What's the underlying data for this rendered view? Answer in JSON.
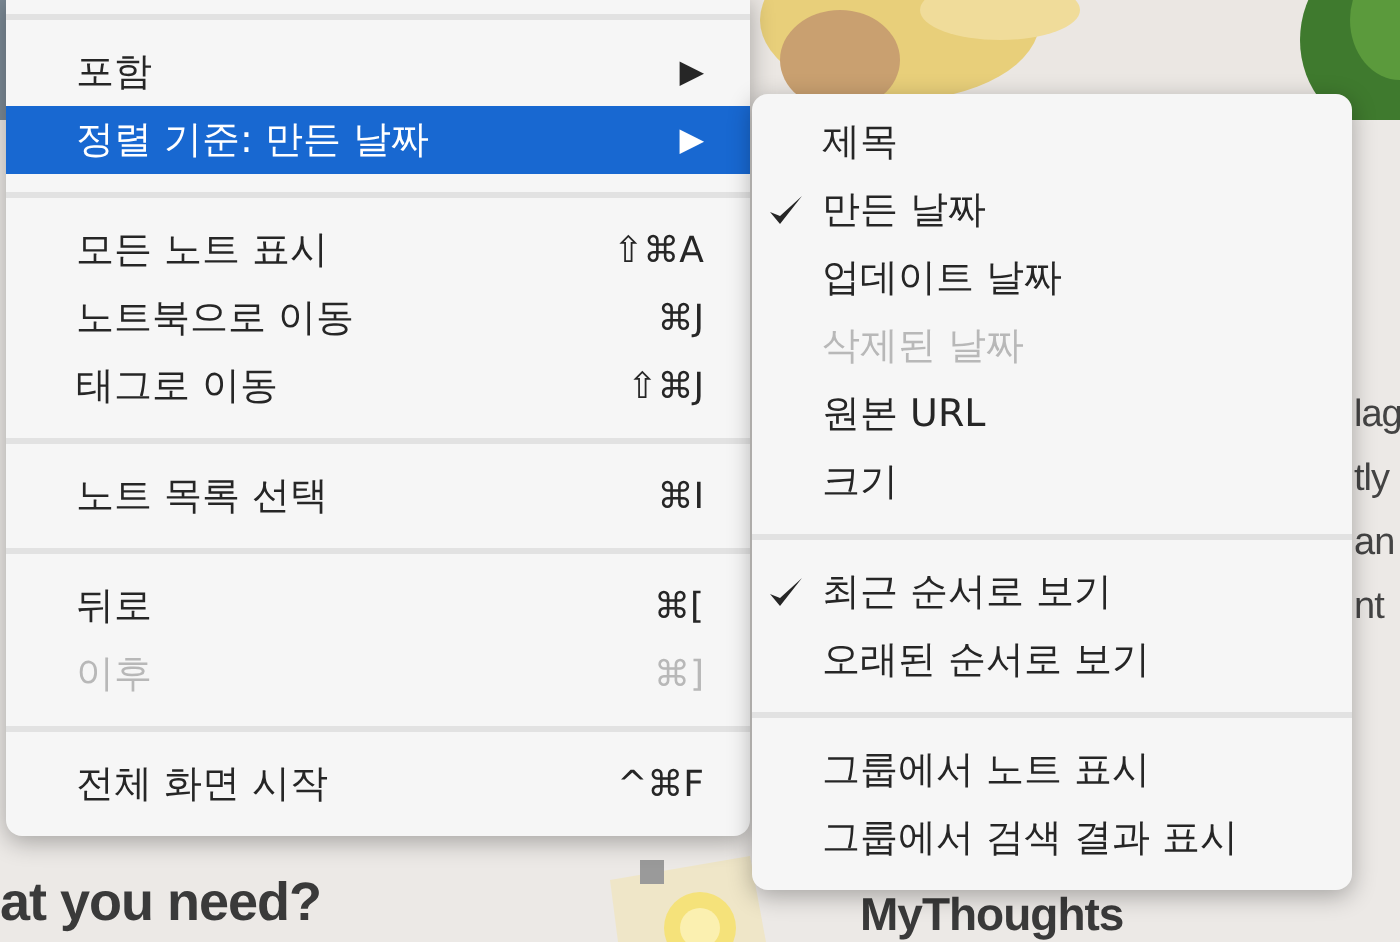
{
  "background": {
    "texts": [
      {
        "kind": "heading",
        "text": "at you need?"
      },
      {
        "kind": "title",
        "text": "MyThoughts"
      },
      {
        "kind": "body",
        "text": "lag"
      },
      {
        "kind": "body",
        "text": "tly"
      },
      {
        "kind": "body",
        "text": "an"
      },
      {
        "kind": "body",
        "text": "nt"
      }
    ]
  },
  "menu": {
    "items": [
      {
        "kind": "separator"
      },
      {
        "kind": "item",
        "label": "포함",
        "arrow": "▶",
        "selected": false,
        "disabled": false
      },
      {
        "kind": "item",
        "label": "정렬 기준: 만든 날짜",
        "arrow": "▶",
        "selected": true,
        "disabled": false
      },
      {
        "kind": "separator"
      },
      {
        "kind": "item",
        "label": "모든 노트 표시",
        "shortcut": "⇧⌘A",
        "selected": false,
        "disabled": false
      },
      {
        "kind": "item",
        "label": "노트북으로 이동",
        "shortcut": "⌘J",
        "selected": false,
        "disabled": false
      },
      {
        "kind": "item",
        "label": "태그로 이동",
        "shortcut": "⇧⌘J",
        "selected": false,
        "disabled": false
      },
      {
        "kind": "separator"
      },
      {
        "kind": "item",
        "label": "노트 목록 선택",
        "shortcut": "⌘I",
        "selected": false,
        "disabled": false
      },
      {
        "kind": "separator"
      },
      {
        "kind": "item",
        "label": "뒤로",
        "shortcut": "⌘[",
        "selected": false,
        "disabled": false
      },
      {
        "kind": "item",
        "label": "이후",
        "shortcut": "⌘]",
        "selected": false,
        "disabled": true
      },
      {
        "kind": "separator"
      },
      {
        "kind": "item",
        "label": "전체 화면 시작",
        "shortcut": "^⌘F",
        "selected": false,
        "disabled": false
      }
    ]
  },
  "submenu": {
    "items": [
      {
        "kind": "item",
        "label": "제목",
        "checked": false,
        "disabled": false
      },
      {
        "kind": "item",
        "label": "만든 날짜",
        "checked": true,
        "disabled": false
      },
      {
        "kind": "item",
        "label": "업데이트 날짜",
        "checked": false,
        "disabled": false
      },
      {
        "kind": "item",
        "label": "삭제된 날짜",
        "checked": false,
        "disabled": true
      },
      {
        "kind": "item",
        "label": "원본 URL",
        "checked": false,
        "disabled": false
      },
      {
        "kind": "item",
        "label": "크기",
        "checked": false,
        "disabled": false
      },
      {
        "kind": "separator"
      },
      {
        "kind": "item",
        "label": "최근 순서로 보기",
        "checked": true,
        "disabled": false
      },
      {
        "kind": "item",
        "label": "오래된 순서로 보기",
        "checked": false,
        "disabled": false
      },
      {
        "kind": "separator"
      },
      {
        "kind": "item",
        "label": "그룹에서 노트 표시",
        "checked": false,
        "disabled": false
      },
      {
        "kind": "item",
        "label": "그룹에서 검색 결과 표시",
        "checked": false,
        "disabled": false
      }
    ]
  }
}
